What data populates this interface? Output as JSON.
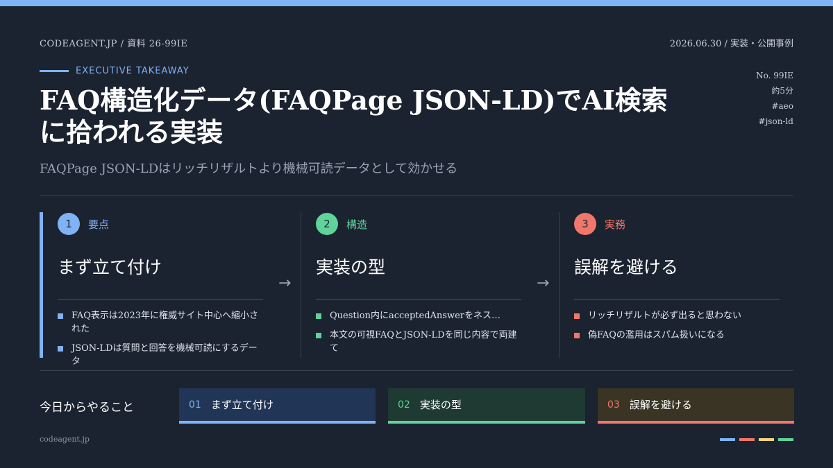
{
  "header": {
    "source": "CODEAGENT.JP / 資料 26-99IE",
    "date_category": "2026.06.30 / 実装・公開事例"
  },
  "kicker": "EXECUTIVE TAKEAWAY",
  "title": "FAQ構造化データ(FAQPage JSON-LD)でAI検索に拾われる実装",
  "subtitle": "FAQPage JSON-LDはリッチリザルトより機械可読データとして効かせる",
  "tags": [
    "No. 99IE",
    "約5分",
    "#aeo",
    "#json-ld"
  ],
  "columns": [
    {
      "num": "1",
      "label": "要点",
      "heading": "まず立て付け",
      "color": "#7fb3f5",
      "bullets": [
        "FAQ表示は2023年に権威サイト中心へ縮小された",
        "JSON-LDは質問と回答を機械可読にするデータ"
      ]
    },
    {
      "num": "2",
      "label": "構造",
      "heading": "実装の型",
      "color": "#5fd39a",
      "bullets": [
        "Question内にacceptedAnswerをネス…",
        "本文の可視FAQとJSON-LDを同じ内容で両建て"
      ]
    },
    {
      "num": "3",
      "label": "実務",
      "heading": "誤解を避ける",
      "color": "#f2776b",
      "bullets": [
        "リッチリザルトが必ず出ると思わない",
        "偽FAQの濫用はスパム扱いになる"
      ]
    }
  ],
  "arrow": "→",
  "todo": {
    "label": "今日からやること",
    "items": [
      {
        "num": "01",
        "text": "まず立て付け"
      },
      {
        "num": "02",
        "text": "実装の型"
      },
      {
        "num": "03",
        "text": "誤解を避ける"
      }
    ]
  },
  "footer": {
    "site": "codeagent.jp"
  },
  "colors": {
    "background": "#1b2230",
    "accent_blue": "#7fb3f5",
    "accent_green": "#5fd39a",
    "accent_red": "#f2776b",
    "accent_yellow": "#f5d77a"
  }
}
